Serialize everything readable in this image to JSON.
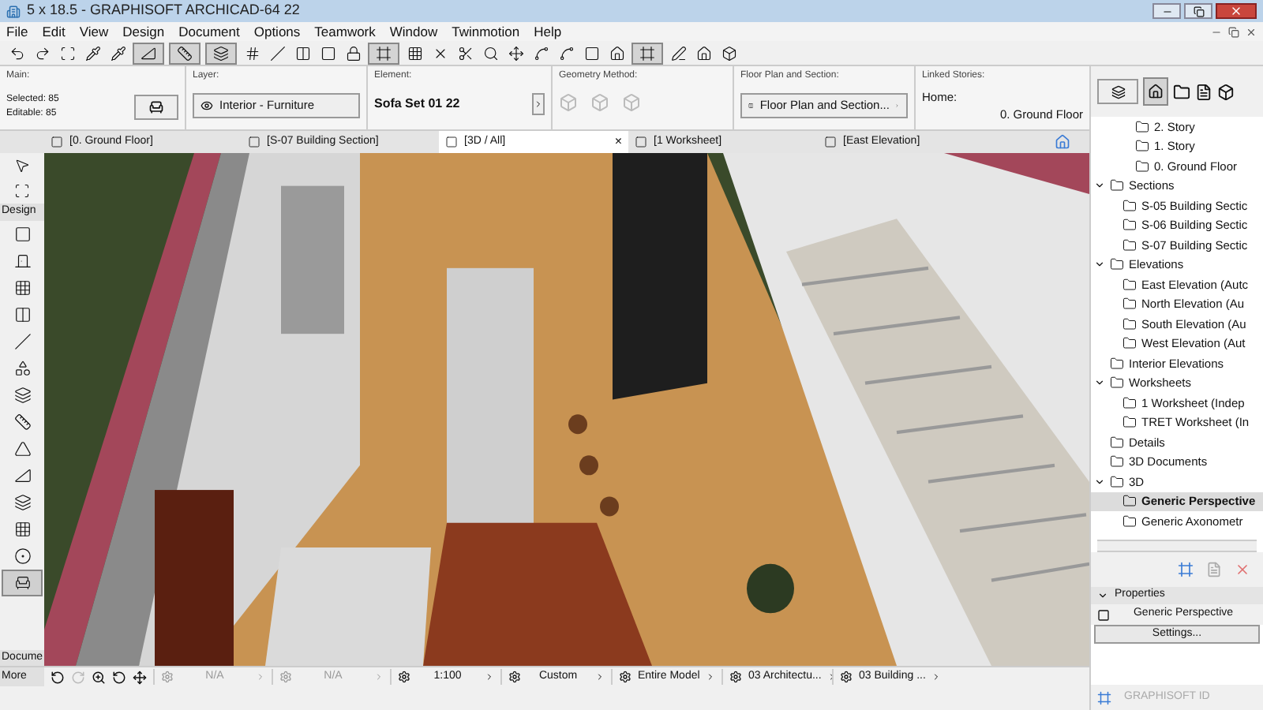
{
  "window": {
    "title": "5 x 18.5 - GRAPHISOFT ARCHICAD-64 22"
  },
  "menu": [
    "File",
    "Edit",
    "View",
    "Design",
    "Document",
    "Options",
    "Teamwork",
    "Window",
    "Twinmotion",
    "Help"
  ],
  "toolbar": [
    {
      "selected": false
    },
    {
      "selected": false
    },
    {
      "selected": false
    },
    {
      "selected": false
    },
    {
      "selected": false
    },
    {
      "selected": true
    },
    {
      "selected": true
    },
    {
      "selected": true
    },
    {
      "selected": false
    },
    {
      "selected": false
    },
    {
      "selected": false
    },
    {
      "selected": false
    },
    {
      "selected": false
    },
    {
      "selected": true
    },
    {
      "selected": false
    },
    {
      "selected": false
    },
    {
      "selected": false
    },
    {
      "selected": false
    },
    {
      "selected": false
    },
    {
      "selected": false
    },
    {
      "selected": false
    },
    {
      "selected": false
    },
    {
      "selected": false
    },
    {
      "selected": true
    },
    {
      "selected": false
    },
    {
      "selected": false
    },
    {
      "selected": false
    }
  ],
  "info_box": {
    "main": {
      "label": "Main:",
      "selected": "Selected: 85",
      "editable": "Editable: 85"
    },
    "layer": {
      "label": "Layer:",
      "value": "Interior - Furniture"
    },
    "element": {
      "label": "Element:",
      "value": "Sofa Set 01 22"
    },
    "geometry": {
      "label": "Geometry Method:"
    },
    "floor_plan": {
      "label": "Floor Plan and Section:",
      "value": "Floor Plan and Section..."
    },
    "linked": {
      "label": "Linked Stories:",
      "home": "Home:",
      "story": "0. Ground Floor"
    }
  },
  "tabs": [
    {
      "label": "[0. Ground Floor]",
      "selected": false
    },
    {
      "label": "[S-07 Building Section]",
      "selected": false
    },
    {
      "label": "[3D / All]",
      "selected": true,
      "close": "×"
    },
    {
      "label": "[1 Worksheet]",
      "selected": false
    },
    {
      "label": "[East Elevation]",
      "selected": false
    }
  ],
  "toolbox": {
    "tools_top": [
      {
        "selected": false
      },
      {
        "selected": false
      }
    ],
    "design_label": "Design",
    "tools": [
      {
        "selected": false
      },
      {
        "selected": false
      },
      {
        "selected": false
      },
      {
        "selected": false
      },
      {
        "selected": false
      },
      {
        "selected": false
      },
      {
        "selected": false
      },
      {
        "selected": false
      },
      {
        "selected": false
      },
      {
        "selected": false
      },
      {
        "selected": false
      },
      {
        "selected": false
      },
      {
        "selected": false
      },
      {
        "selected": true
      }
    ],
    "document_label": "Docume",
    "more_label": "More"
  },
  "status_bar": [
    {
      "text": "N/A",
      "disabled": true
    },
    {
      "text": "N/A",
      "disabled": true
    },
    {
      "text": "1:100",
      "disabled": false
    },
    {
      "text": "Custom",
      "disabled": false
    },
    {
      "text": "Entire Model",
      "disabled": false
    },
    {
      "text": "03 Architectu...",
      "disabled": false
    },
    {
      "text": "03 Building ...",
      "disabled": false
    }
  ],
  "navigator": {
    "stories": [
      {
        "label": "2. Story",
        "selected": false
      },
      {
        "label": "1. Story",
        "selected": false
      },
      {
        "label": "0. Ground Floor",
        "selected": false
      }
    ],
    "tree": [
      {
        "label": "Sections",
        "selected": false,
        "expanded": true,
        "children": [
          {
            "label": "S-05 Building Sectic",
            "selected": false
          },
          {
            "label": "S-06 Building Sectic",
            "selected": false
          },
          {
            "label": "S-07 Building Sectic",
            "selected": false
          }
        ]
      },
      {
        "label": "Elevations",
        "selected": false,
        "expanded": true,
        "children": [
          {
            "label": "East Elevation (Autc",
            "selected": false
          },
          {
            "label": "North Elevation (Au",
            "selected": false
          },
          {
            "label": "South Elevation (Au",
            "selected": false
          },
          {
            "label": "West Elevation (Aut",
            "selected": false
          }
        ]
      },
      {
        "label": "Interior Elevations",
        "selected": false
      },
      {
        "label": "Worksheets",
        "selected": false,
        "expanded": true,
        "children": [
          {
            "label": "1 Worksheet (Indep",
            "selected": false
          },
          {
            "label": "TRET Worksheet (In",
            "selected": false
          }
        ]
      },
      {
        "label": "Details",
        "selected": false
      },
      {
        "label": "3D Documents",
        "selected": false
      },
      {
        "label": "3D",
        "selected": false,
        "expanded": true,
        "children": [
          {
            "label": "Generic Perspective",
            "selected": true
          },
          {
            "label": "Generic Axonometr",
            "selected": false
          }
        ]
      }
    ],
    "properties": {
      "title": "Properties",
      "expanded": true,
      "name": "Generic Perspective",
      "settings": "Settings..."
    },
    "footer": "GRAPHISOFT ID"
  }
}
